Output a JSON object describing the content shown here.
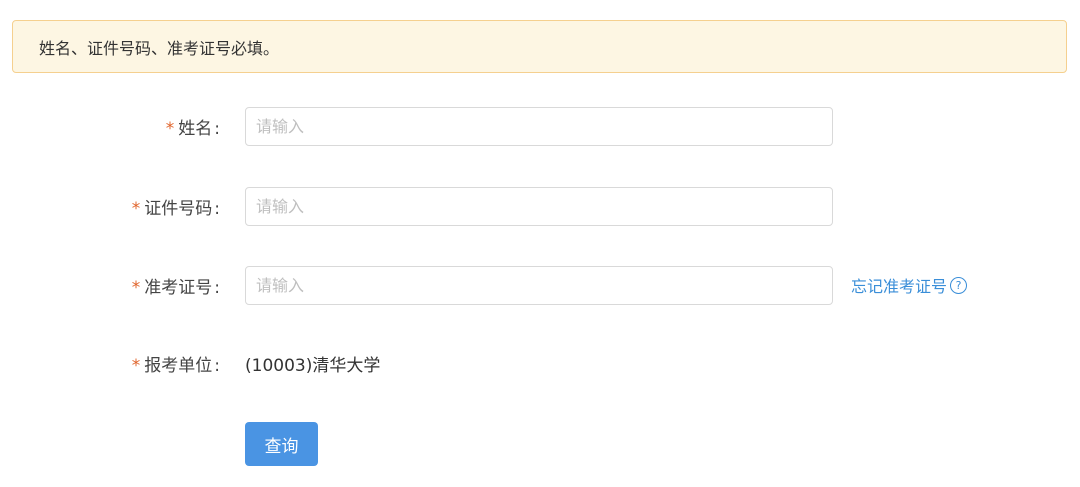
{
  "notice": {
    "text": "姓名、证件号码、准考证号必填。"
  },
  "form": {
    "required_mark": "*",
    "name": {
      "label": "姓名",
      "placeholder": "请输入",
      "value": ""
    },
    "id_number": {
      "label": "证件号码",
      "placeholder": "请输入",
      "value": ""
    },
    "exam_number": {
      "label": "准考证号",
      "placeholder": "请输入",
      "value": "",
      "forgot_link": "忘记准考证号",
      "help_icon": "question-circle-icon"
    },
    "exam_unit": {
      "label": "报考单位",
      "value": "(10003)清华大学"
    },
    "colon": ":"
  },
  "submit": {
    "label": "查询"
  },
  "colors": {
    "accent": "#4a94e3",
    "link": "#3a8ed8",
    "required": "#e0642b",
    "notice_bg": "#fdf6e3",
    "notice_border": "#f5d08f"
  }
}
